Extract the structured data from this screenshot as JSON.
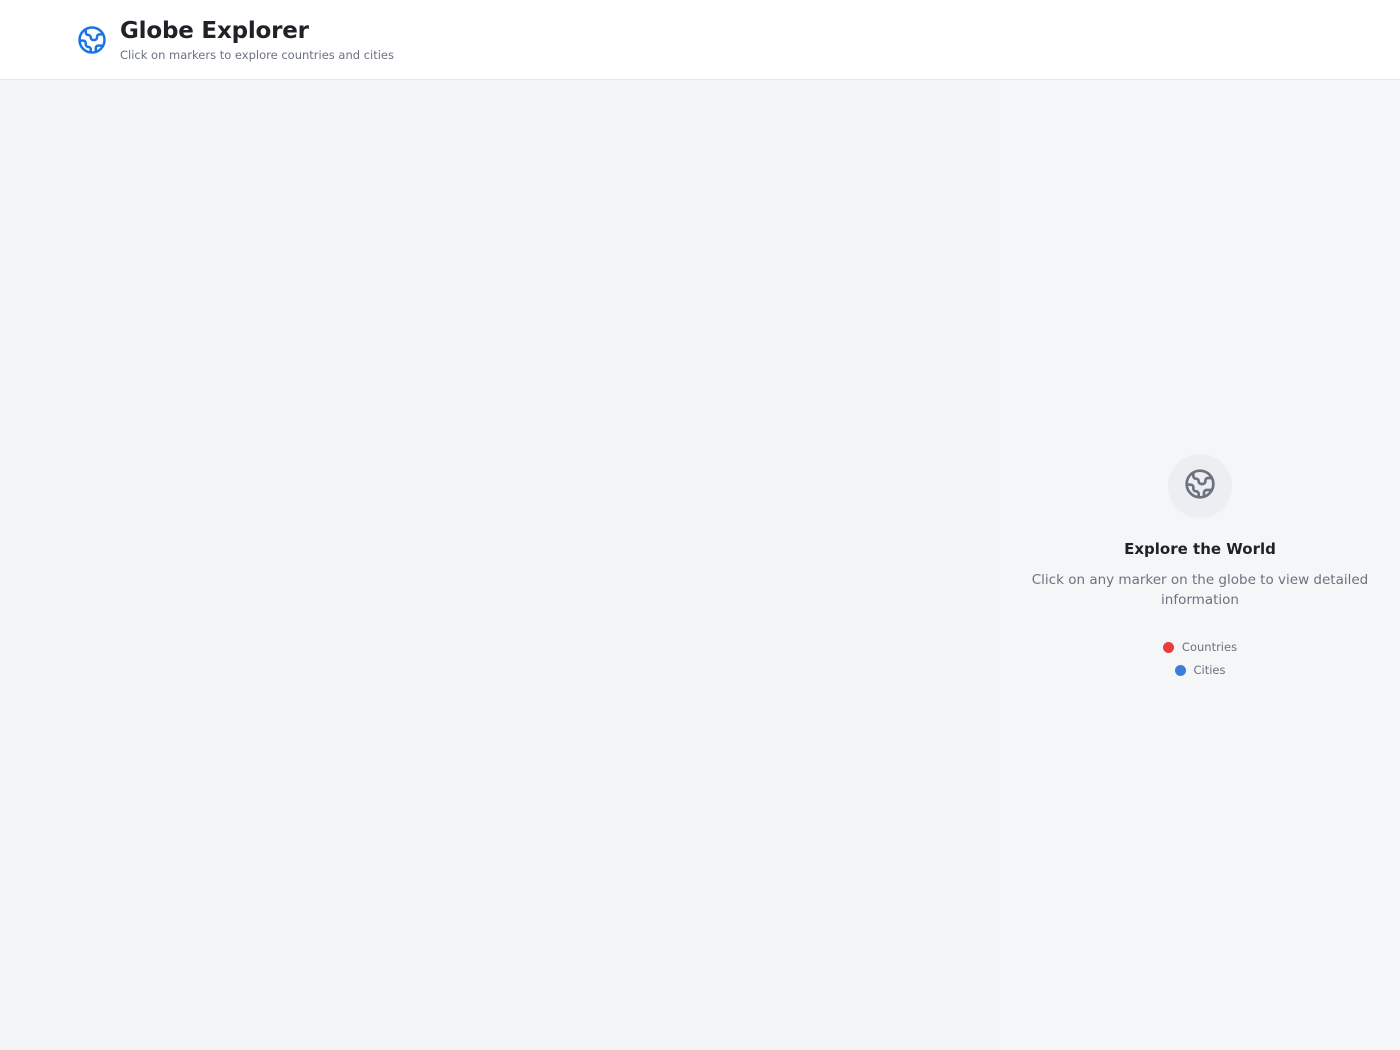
{
  "header": {
    "title": "Globe Explorer",
    "subtitle": "Click on markers to explore countries and cities",
    "logo_icon": "globe-icon",
    "accent": "#1a73e8"
  },
  "panel": {
    "icon": "globe-icon",
    "title": "Explore the World",
    "description": "Click on any marker on the globe to view detailed information",
    "legend": [
      {
        "label": "Countries",
        "color": "#e53e3e"
      },
      {
        "label": "Cities",
        "color": "#3b7ddd"
      }
    ]
  }
}
